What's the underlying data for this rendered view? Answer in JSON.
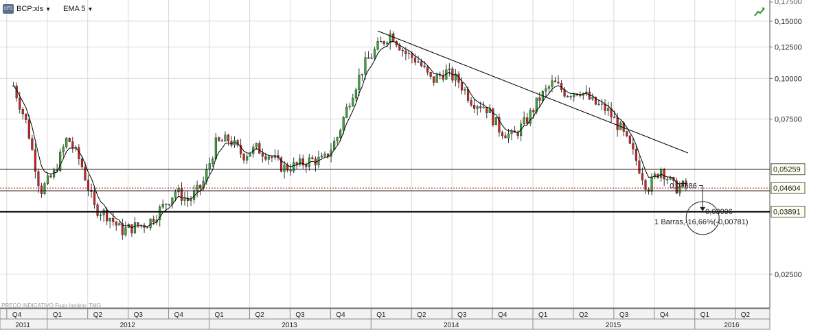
{
  "toolbar": {
    "symbol_label": "BCP:xls",
    "indicator_label": "EMA 5",
    "badge_text": "CFD",
    "caret": "▼"
  },
  "footer": {
    "note": "PRECO INDICATIVO   Fuso horário: TMG"
  },
  "icons": {
    "badge": "cfd-icon",
    "corner": "trend-chart-icon"
  },
  "colors": {
    "up": "#33aa33",
    "down": "#cc2222",
    "line": "#000000",
    "grid": "#d9d9d9",
    "price_box_bg": "#fffff0",
    "dotted_line": "#cc0000"
  },
  "chart_data": {
    "type": "candlestick",
    "scale": "log",
    "y_ticks": [
      "0,02500",
      "0,07500",
      "0,10000",
      "0,12500",
      "0,15000"
    ],
    "x_quarter_labels": [
      "Q4",
      "Q1",
      "Q2",
      "Q3",
      "Q4",
      "Q1",
      "Q2",
      "Q3",
      "Q4",
      "Q1",
      "Q2",
      "Q3",
      "Q4",
      "Q1",
      "Q2",
      "Q3",
      "Q4",
      "Q1",
      "Q2"
    ],
    "x_year_labels": [
      "2011",
      "2012",
      "2013",
      "2014",
      "2015",
      "2016"
    ],
    "overlays": {
      "ema_label": "EMA 5",
      "trendline": {
        "from": [
          "2014-01",
          0.14
        ],
        "to": [
          "2015-12",
          0.059
        ]
      },
      "horizontal_levels": [
        {
          "value": 0.05259,
          "label": "0,05259",
          "style": "solid"
        },
        {
          "value": 0.04604,
          "label": "0,04604",
          "style": "dotted"
        },
        {
          "value": 0.03891,
          "label": "0,03891",
          "style": "bold"
        }
      ],
      "measure_tool": {
        "from_value_label": "0,04686",
        "to_value_label": "0,03906",
        "result_label": "1 Barras,-16,66%(-0,00781)"
      }
    },
    "weekly_close_path": [
      {
        "t": "2011-10",
        "v": 0.095
      },
      {
        "t": "2011-11",
        "v": 0.072
      },
      {
        "t": "2011-12",
        "v": 0.045
      },
      {
        "t": "2012-01",
        "v": 0.051
      },
      {
        "t": "2012-02",
        "v": 0.066
      },
      {
        "t": "2012-03",
        "v": 0.055
      },
      {
        "t": "2012-04",
        "v": 0.04
      },
      {
        "t": "2012-05",
        "v": 0.038
      },
      {
        "t": "2012-06",
        "v": 0.034
      },
      {
        "t": "2012-07",
        "v": 0.035
      },
      {
        "t": "2012-08",
        "v": 0.036
      },
      {
        "t": "2012-09",
        "v": 0.04
      },
      {
        "t": "2012-10",
        "v": 0.045
      },
      {
        "t": "2012-11",
        "v": 0.042
      },
      {
        "t": "2012-12",
        "v": 0.047
      },
      {
        "t": "2013-01",
        "v": 0.063
      },
      {
        "t": "2013-02",
        "v": 0.065
      },
      {
        "t": "2013-03",
        "v": 0.058
      },
      {
        "t": "2013-04",
        "v": 0.061
      },
      {
        "t": "2013-05",
        "v": 0.058
      },
      {
        "t": "2013-06",
        "v": 0.053
      },
      {
        "t": "2013-07",
        "v": 0.054
      },
      {
        "t": "2013-08",
        "v": 0.056
      },
      {
        "t": "2013-09",
        "v": 0.056
      },
      {
        "t": "2013-10",
        "v": 0.066
      },
      {
        "t": "2013-11",
        "v": 0.088
      },
      {
        "t": "2013-12",
        "v": 0.11
      },
      {
        "t": "2014-01",
        "v": 0.125
      },
      {
        "t": "2014-02",
        "v": 0.138
      },
      {
        "t": "2014-03",
        "v": 0.12
      },
      {
        "t": "2014-04",
        "v": 0.113
      },
      {
        "t": "2014-05",
        "v": 0.098
      },
      {
        "t": "2014-06",
        "v": 0.105
      },
      {
        "t": "2014-07",
        "v": 0.098
      },
      {
        "t": "2014-08",
        "v": 0.085
      },
      {
        "t": "2014-09",
        "v": 0.082
      },
      {
        "t": "2014-10",
        "v": 0.07
      },
      {
        "t": "2014-11",
        "v": 0.066
      },
      {
        "t": "2014-12",
        "v": 0.074
      },
      {
        "t": "2015-01",
        "v": 0.087
      },
      {
        "t": "2015-02",
        "v": 0.097
      },
      {
        "t": "2015-03",
        "v": 0.09
      },
      {
        "t": "2015-04",
        "v": 0.092
      },
      {
        "t": "2015-05",
        "v": 0.084
      },
      {
        "t": "2015-06",
        "v": 0.08
      },
      {
        "t": "2015-07",
        "v": 0.07
      },
      {
        "t": "2015-08",
        "v": 0.058
      },
      {
        "t": "2015-09",
        "v": 0.046
      },
      {
        "t": "2015-10",
        "v": 0.053
      },
      {
        "t": "2015-11",
        "v": 0.046
      },
      {
        "t": "2015-12",
        "v": 0.047
      }
    ]
  }
}
